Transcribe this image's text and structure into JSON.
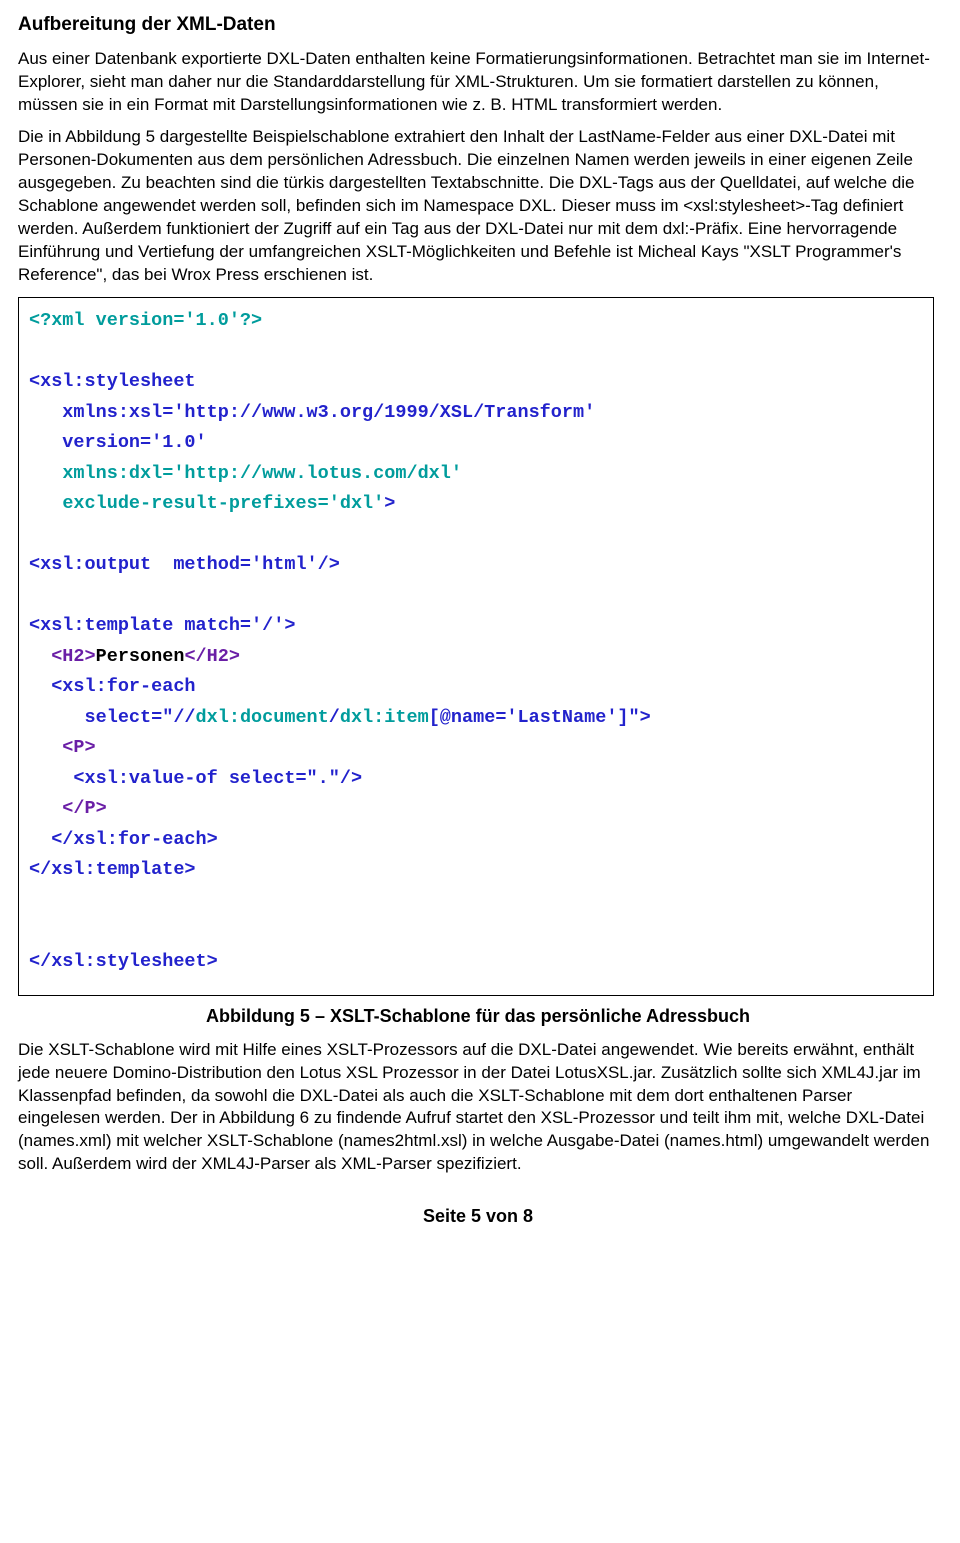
{
  "title": "Aufbereitung der XML-Daten",
  "para1": "Aus einer Datenbank exportierte DXL-Daten enthalten keine Formatierungsinformationen. Betrachtet man sie im Internet-Explorer, sieht man daher nur die Standarddarstellung für XML-Strukturen. Um sie formatiert darstellen zu können, müssen sie in ein Format mit Darstellungsinformationen wie z. B. HTML transformiert werden.",
  "para2": "Die in Abbildung 5 dargestellte Beispielschablone extrahiert den Inhalt der LastName-Felder aus einer DXL-Datei mit Personen-Dokumenten aus dem persönlichen Adressbuch. Die einzelnen Namen werden jeweils in einer eigenen Zeile ausgegeben. Zu beachten sind die türkis dargestellten Textabschnitte. Die DXL-Tags aus der Quelldatei, auf welche die Schablone angewendet werden soll, befinden sich im Namespace DXL. Dieser muss im <xsl:stylesheet>-Tag definiert werden. Außerdem funktioniert der Zugriff auf ein Tag aus der DXL-Datei nur mit dem dxl:-Präfix. Eine hervorragende Einführung und Vertiefung der umfangreichen XSLT-Möglichkeiten und Befehle ist Micheal Kays \"XSLT Programmer's Reference\", das bei Wrox Press erschienen ist.",
  "code": {
    "l1": "<?xml version='1.0'?>",
    "l2": "",
    "l3a": "<xsl:stylesheet",
    "l4a": "   xmlns:xsl='http://www.w3.org/1999/XSL/Transform'",
    "l5a": "   version='1.0'",
    "l6a": "   ",
    "l6b": "xmlns:dxl='http://www.lotus.com/dxl'",
    "l7a": "   ",
    "l7b": "exclude-result-prefixes='dxl'",
    "l7c": ">",
    "l8": "",
    "l9": "<xsl:output  method='html'/>",
    "l10": "",
    "l11": "<xsl:template match='/'>",
    "l12a": "  <H2>",
    "l12b": "Personen",
    "l12c": "</H2>",
    "l13": "  <xsl:for-each",
    "l14a": "     select=\"//",
    "l14b": "dxl:document",
    "l14c": "/",
    "l14d": "dxl:item",
    "l14e": "[@name='LastName']\">",
    "l15": "   <P>",
    "l16": "    <xsl:value-of select=\".\"/>",
    "l17": "   </P>",
    "l18": "  </xsl:for-each>",
    "l19": "</xsl:template>",
    "l20": "",
    "l21": "",
    "l22": "</xsl:stylesheet>"
  },
  "figcaption": "Abbildung 5 – XSLT-Schablone für das persönliche Adressbuch",
  "para3": "Die XSLT-Schablone wird mit Hilfe eines XSLT-Prozessors auf die DXL-Datei angewendet. Wie bereits erwähnt, enthält jede neuere Domino-Distribution den Lotus XSL Prozessor in der Datei LotusXSL.jar. Zusätzlich sollte sich XML4J.jar im Klassenpfad befinden, da sowohl die DXL-Datei als auch die XSLT-Schablone mit dem dort enthaltenen Parser eingelesen werden. Der in Abbildung 6 zu findende Aufruf startet den XSL-Prozessor und teilt ihm mit, welche DXL-Datei (names.xml) mit welcher XSLT-Schablone (names2html.xsl) in welche Ausgabe-Datei (names.html) umgewandelt werden soll. Außerdem wird der XML4J-Parser als XML-Parser spezifiziert.",
  "footer": "Seite 5 von 8"
}
